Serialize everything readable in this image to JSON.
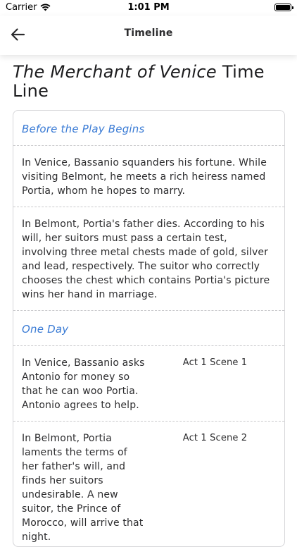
{
  "status_bar": {
    "carrier": "Carrier",
    "time": "1:01 PM"
  },
  "nav": {
    "title": "Timeline"
  },
  "page": {
    "title_italic": "The Merchant of Venice",
    "title_rest": " Time Line"
  },
  "sections": [
    {
      "header": "Before the Play Begins",
      "entries": [
        "In Venice, Bassanio squanders his fortune. While visiting Belmont, he meets a rich heiress named Portia, whom he hopes to marry.",
        "In Belmont, Portia's father dies. According to his will, her suitors must pass a certain test, involving three metal chests made of gold, silver and lead, respectively. The suitor who correctly chooses the chest which contains Portia's picture wins her hand in marriage."
      ]
    },
    {
      "header": "One Day",
      "entries": [
        {
          "text": "In Venice, Bassanio asks Antonio for money so that he can woo Portia. Antonio agrees to help.",
          "ref": "Act 1 Scene 1"
        },
        {
          "text": "In Belmont, Portia laments the terms of her father's will, and finds her suitors undesirable. A new suitor, the Prince of Morocco, will arrive that night.",
          "ref": "Act 1 Scene 2"
        }
      ]
    }
  ],
  "colors": {
    "accent": "#3a7bd5",
    "border": "#d6d6d9"
  }
}
